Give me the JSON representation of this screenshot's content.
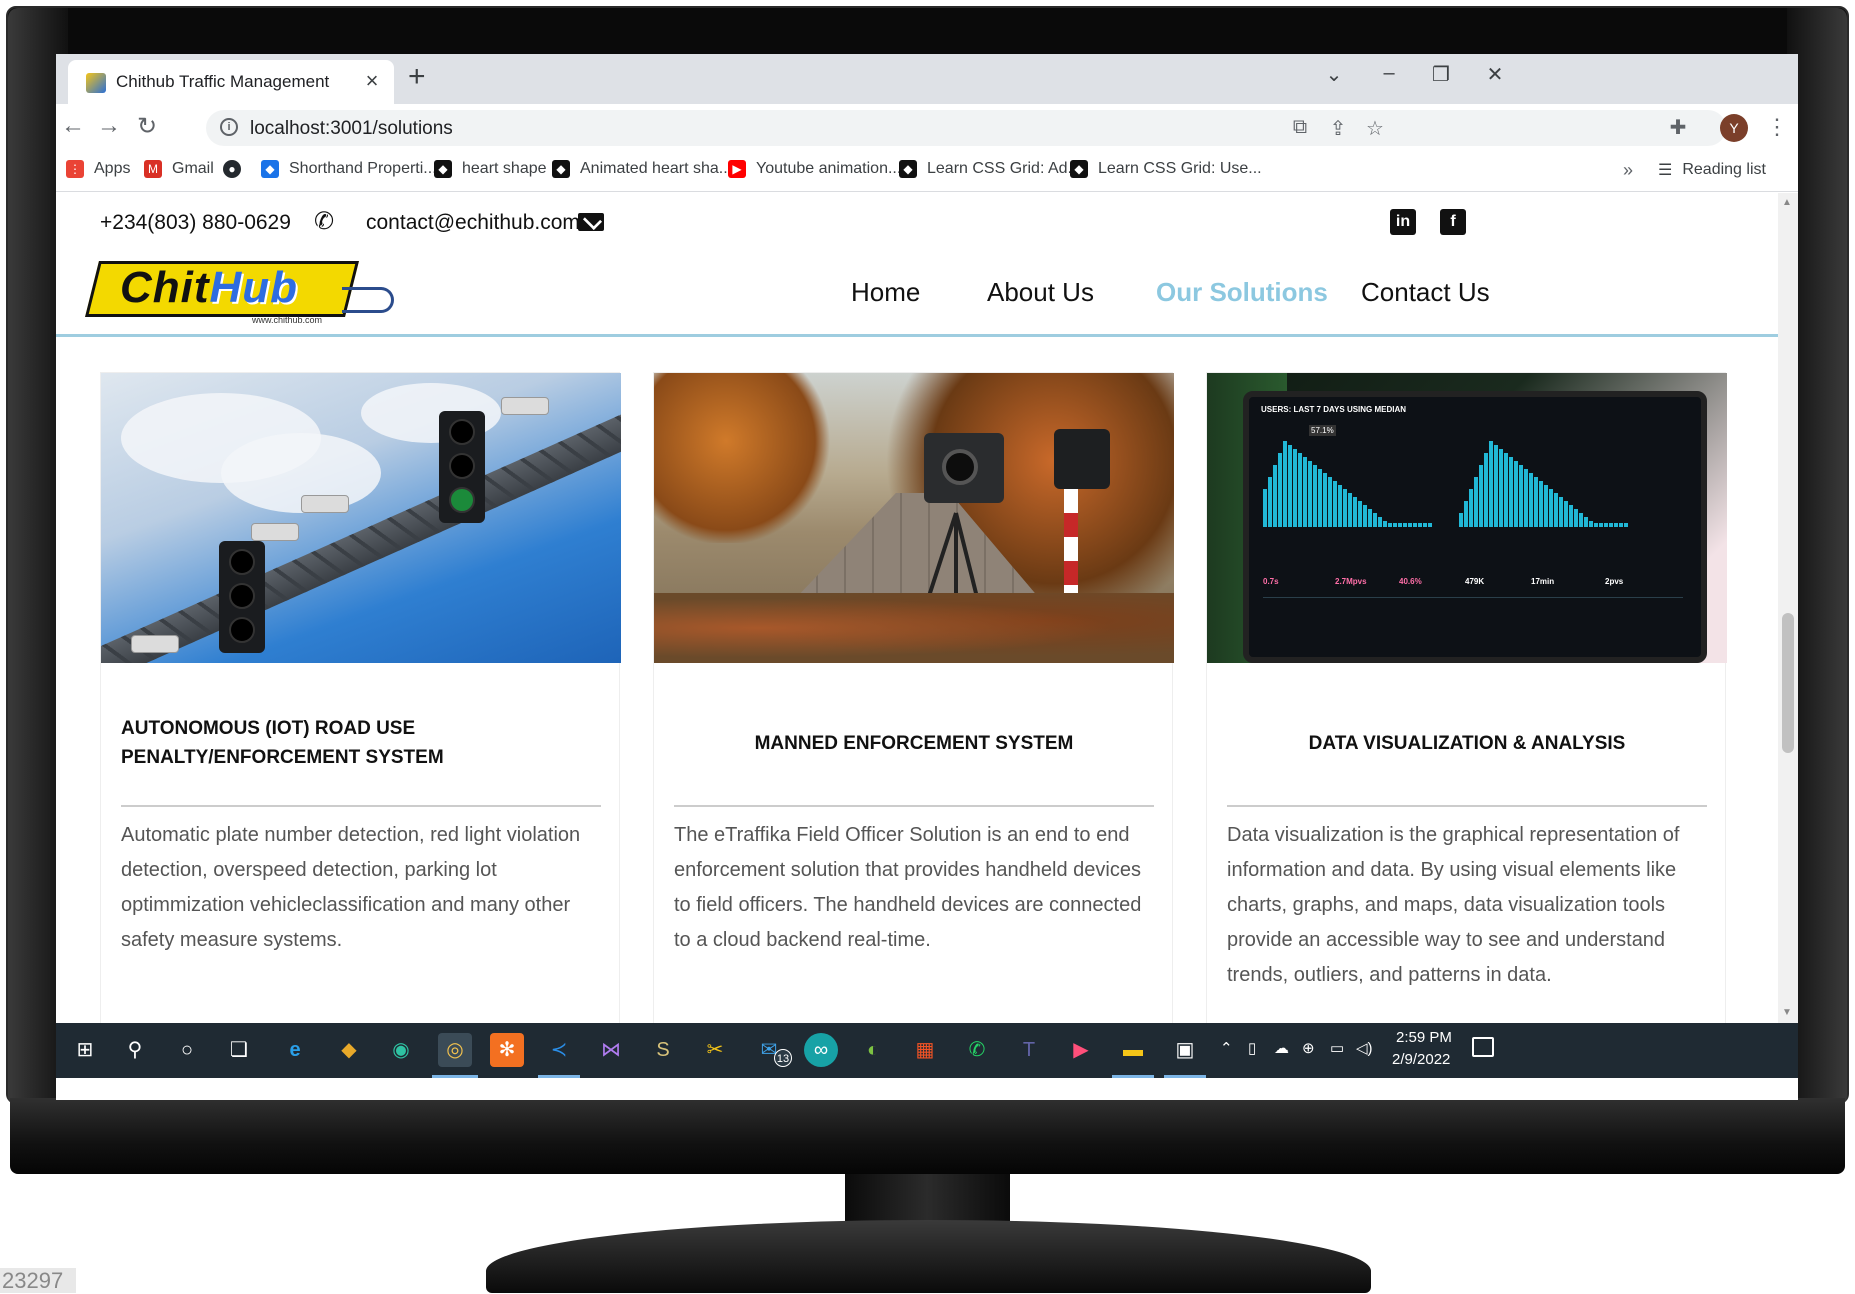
{
  "browser": {
    "tab_title": "Chithub Traffic Management",
    "url": "localhost:3001/solutions",
    "avatar_letter": "Y",
    "bookmarks": [
      {
        "label": "Apps",
        "icon": "apps-grid-icon",
        "color": "#ea4335"
      },
      {
        "label": "Gmail",
        "icon": "gmail-icon",
        "color": "#d93025"
      },
      {
        "label": "",
        "icon": "github-icon",
        "color": "#24292e"
      },
      {
        "label": "Shorthand Properti...",
        "icon": "codepen-icon",
        "color": "#1a73e8"
      },
      {
        "label": "heart shape",
        "icon": "codepen-icon",
        "color": "#111111"
      },
      {
        "label": "Animated heart sha...",
        "icon": "codepen-icon",
        "color": "#111111"
      },
      {
        "label": "Youtube animation...",
        "icon": "youtube-icon",
        "color": "#ff0000"
      },
      {
        "label": "Learn CSS Grid: Ad...",
        "icon": "codepen-icon",
        "color": "#111111"
      },
      {
        "label": "Learn CSS Grid: Use...",
        "icon": "codepen-icon",
        "color": "#111111"
      }
    ],
    "bookmarks_more": "»",
    "reading_list": "Reading list"
  },
  "site": {
    "phone": "+234(803) 880-0629",
    "email": "contact@echithub.com",
    "logo_chit": "Chit",
    "logo_hub": "Hub",
    "logo_url": "www.chithub.com",
    "nav": {
      "home": "Home",
      "about": "About Us",
      "solutions": "Our Solutions",
      "contact": "Contact Us"
    },
    "social": {
      "linkedin": "in",
      "facebook": "f"
    },
    "active_color": "#8cc8e0"
  },
  "cards": [
    {
      "title": "AUTONOMOUS (IOT) ROAD USE PENALTY/ENFORCEMENT SYSTEM",
      "description": "Automatic plate number detection, red light violation detection, overspeed detection, parking lot optimmization vehicleclassification and many other safety measure systems."
    },
    {
      "title": "MANNED ENFORCEMENT SYSTEM",
      "description": "The eTraffika Field Officer Solution is an end to end enforcement solution that provides handheld devices to field officers. The handheld devices are connected to a cloud backend real-time."
    },
    {
      "title": "DATA VISUALIZATION & ANALYSIS",
      "description": "Data visualization is the graphical representation of information and data. By using visual elements like charts, graphs, and maps, data visualization tools provide an accessible way to see and understand trends, outliers, and patterns in data."
    }
  ],
  "dashboard_image": {
    "title": "USERS: LAST 7 DAYS USING MEDIAN",
    "metrics": [
      "0.7s",
      "2.7Mpvs",
      "40.6%",
      "479K",
      "17min",
      "2pvs"
    ],
    "peak_label": "57.1%"
  },
  "taskbar": {
    "time": "2:59 PM",
    "date": "2/9/2022",
    "mail_badge": "13"
  },
  "watermark": "23297"
}
